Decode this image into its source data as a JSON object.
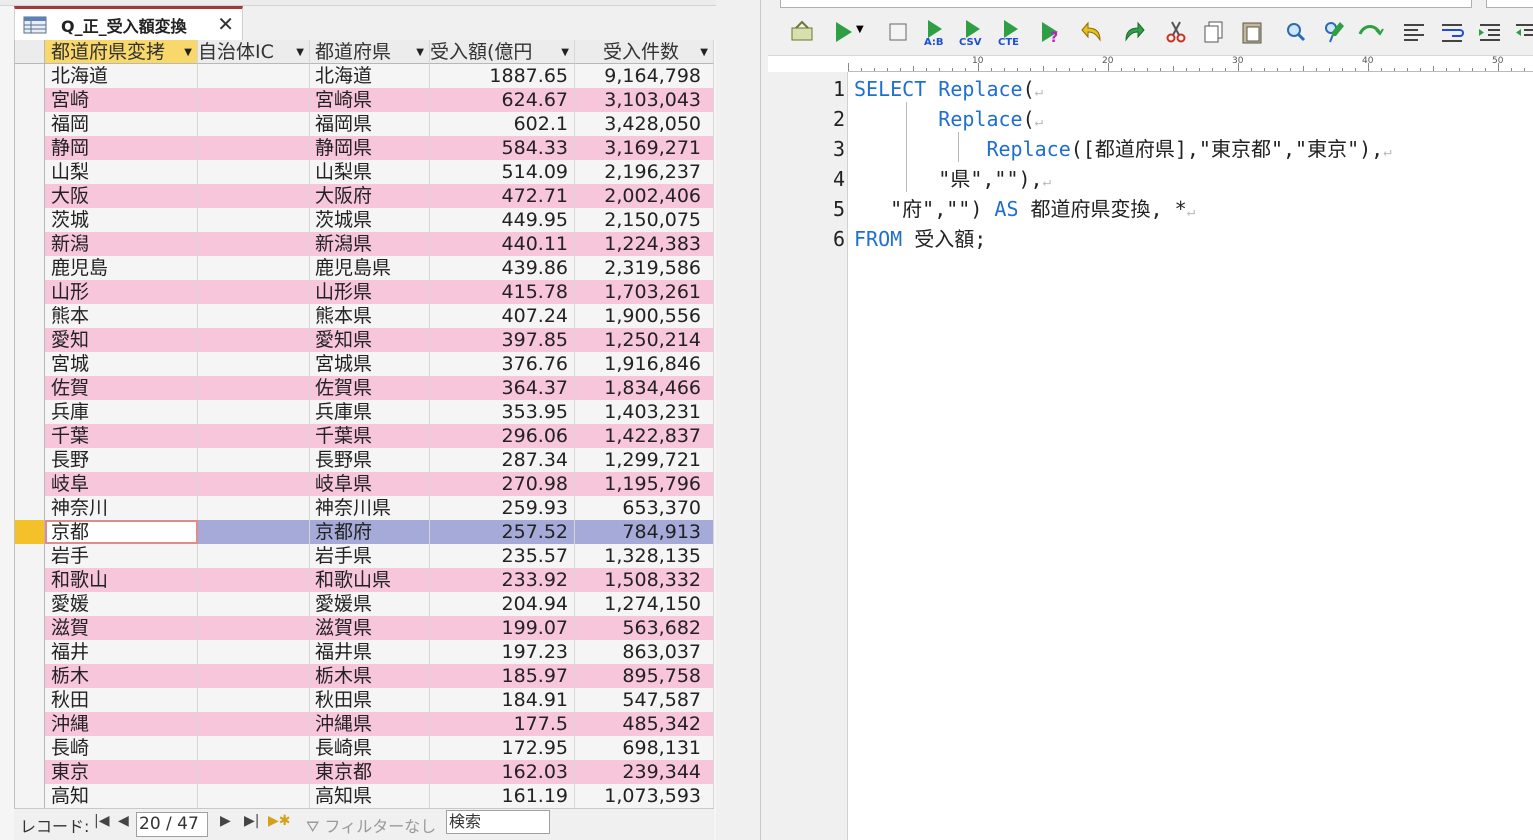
{
  "access": {
    "tab_title": "Q_正_受入額変換",
    "tab_close": "✕",
    "columns": [
      "都道府県変換",
      "自治体ID",
      "都道府県",
      "受入額(億円)",
      "受入件数"
    ],
    "column_visible": [
      "都道府県変拷",
      "自治体IC",
      "都道府県",
      "受入額(億円",
      "受入件数"
    ],
    "rows": [
      {
        "a": "北海道",
        "b": "",
        "c": "北海道",
        "d": "1887.65",
        "e": "9,164,798"
      },
      {
        "a": "宮崎",
        "b": "",
        "c": "宮崎県",
        "d": "624.67",
        "e": "3,103,043"
      },
      {
        "a": "福岡",
        "b": "",
        "c": "福岡県",
        "d": "602.1",
        "e": "3,428,050"
      },
      {
        "a": "静岡",
        "b": "",
        "c": "静岡県",
        "d": "584.33",
        "e": "3,169,271"
      },
      {
        "a": "山梨",
        "b": "",
        "c": "山梨県",
        "d": "514.09",
        "e": "2,196,237"
      },
      {
        "a": "大阪",
        "b": "",
        "c": "大阪府",
        "d": "472.71",
        "e": "2,002,406"
      },
      {
        "a": "茨城",
        "b": "",
        "c": "茨城県",
        "d": "449.95",
        "e": "2,150,075"
      },
      {
        "a": "新潟",
        "b": "",
        "c": "新潟県",
        "d": "440.11",
        "e": "1,224,383"
      },
      {
        "a": "鹿児島",
        "b": "",
        "c": "鹿児島県",
        "d": "439.86",
        "e": "2,319,586"
      },
      {
        "a": "山形",
        "b": "",
        "c": "山形県",
        "d": "415.78",
        "e": "1,703,261"
      },
      {
        "a": "熊本",
        "b": "",
        "c": "熊本県",
        "d": "407.24",
        "e": "1,900,556"
      },
      {
        "a": "愛知",
        "b": "",
        "c": "愛知県",
        "d": "397.85",
        "e": "1,250,214"
      },
      {
        "a": "宮城",
        "b": "",
        "c": "宮城県",
        "d": "376.76",
        "e": "1,916,846"
      },
      {
        "a": "佐賀",
        "b": "",
        "c": "佐賀県",
        "d": "364.37",
        "e": "1,834,466"
      },
      {
        "a": "兵庫",
        "b": "",
        "c": "兵庫県",
        "d": "353.95",
        "e": "1,403,231"
      },
      {
        "a": "千葉",
        "b": "",
        "c": "千葉県",
        "d": "296.06",
        "e": "1,422,837"
      },
      {
        "a": "長野",
        "b": "",
        "c": "長野県",
        "d": "287.34",
        "e": "1,299,721"
      },
      {
        "a": "岐阜",
        "b": "",
        "c": "岐阜県",
        "d": "270.98",
        "e": "1,195,796"
      },
      {
        "a": "神奈川",
        "b": "",
        "c": "神奈川県",
        "d": "259.93",
        "e": "653,370"
      },
      {
        "a": "京都",
        "b": "",
        "c": "京都府",
        "d": "257.52",
        "e": "784,913"
      },
      {
        "a": "岩手",
        "b": "",
        "c": "岩手県",
        "d": "235.57",
        "e": "1,328,135"
      },
      {
        "a": "和歌山",
        "b": "",
        "c": "和歌山県",
        "d": "233.92",
        "e": "1,508,332"
      },
      {
        "a": "愛媛",
        "b": "",
        "c": "愛媛県",
        "d": "204.94",
        "e": "1,274,150"
      },
      {
        "a": "滋賀",
        "b": "",
        "c": "滋賀県",
        "d": "199.07",
        "e": "563,682"
      },
      {
        "a": "福井",
        "b": "",
        "c": "福井県",
        "d": "197.23",
        "e": "863,037"
      },
      {
        "a": "栃木",
        "b": "",
        "c": "栃木県",
        "d": "185.97",
        "e": "895,758"
      },
      {
        "a": "秋田",
        "b": "",
        "c": "秋田県",
        "d": "184.91",
        "e": "547,587"
      },
      {
        "a": "沖縄",
        "b": "",
        "c": "沖縄県",
        "d": "177.5",
        "e": "485,342"
      },
      {
        "a": "長崎",
        "b": "",
        "c": "長崎県",
        "d": "172.95",
        "e": "698,131"
      },
      {
        "a": "東京",
        "b": "",
        "c": "東京都",
        "d": "162.03",
        "e": "239,344"
      },
      {
        "a": "高知",
        "b": "",
        "c": "高知県",
        "d": "161.19",
        "e": "1,073,593"
      }
    ],
    "current_row_index": 19,
    "nav": {
      "record_label": "レコード:",
      "first": "|◀",
      "prev": "◀",
      "position": "20 / 47",
      "next": "▶",
      "last": "▶|",
      "new": "▶✱",
      "filter": "フィルターなし",
      "search": "検索"
    },
    "colors": {
      "row_even": "#f8c6da",
      "row_odd": "#f5f5f5",
      "row_current": "#a6aad8",
      "header_active": "#f8d86a",
      "tab_accent": "#a4373a"
    }
  },
  "editor": {
    "ruler_labels": [
      "10",
      "20",
      "30",
      "40",
      "50"
    ],
    "line_numbers": [
      "1",
      "2",
      "3",
      "4",
      "5",
      "6"
    ],
    "lines": [
      {
        "parts": [
          {
            "t": "SELECT",
            "k": true
          },
          {
            "t": " "
          },
          {
            "t": "Replace",
            "k": true
          },
          {
            "t": "("
          }
        ]
      },
      {
        "parts": [
          {
            "t": "       "
          },
          {
            "t": "Replace",
            "k": true
          },
          {
            "t": "("
          }
        ]
      },
      {
        "parts": [
          {
            "t": "           "
          },
          {
            "t": "Replace",
            "k": true
          },
          {
            "t": "([都道府県],\"東京都\",\"東京\"),"
          }
        ]
      },
      {
        "parts": [
          {
            "t": "       \"県\",\"\"),"
          }
        ]
      },
      {
        "parts": [
          {
            "t": "   \"府\",\"\") "
          },
          {
            "t": "AS",
            "k": true
          },
          {
            "t": " 都道府県変換, *"
          }
        ]
      },
      {
        "parts": [
          {
            "t": "FROM",
            "k": true
          },
          {
            "t": " 受入額;"
          }
        ]
      }
    ],
    "eol_marker": "↵",
    "toolbar_icons": [
      "open-icon",
      "run-icon",
      "stop-icon",
      "run-ab-icon",
      "csv-icon",
      "cte-icon",
      "run-help-icon",
      "undo-icon",
      "redo-icon",
      "cut-icon",
      "copy-icon",
      "paste-icon",
      "find-icon",
      "replace-icon",
      "format-icon",
      "align-icon",
      "wrap-icon",
      "indent-icon",
      "outdent-icon"
    ],
    "toolbar_labels": {
      "ab": "A:B",
      "csv": "CSV",
      "cte": "CTE",
      "help": "?"
    },
    "colors": {
      "keyword": "#1f6fd0",
      "text": "#222222"
    }
  }
}
